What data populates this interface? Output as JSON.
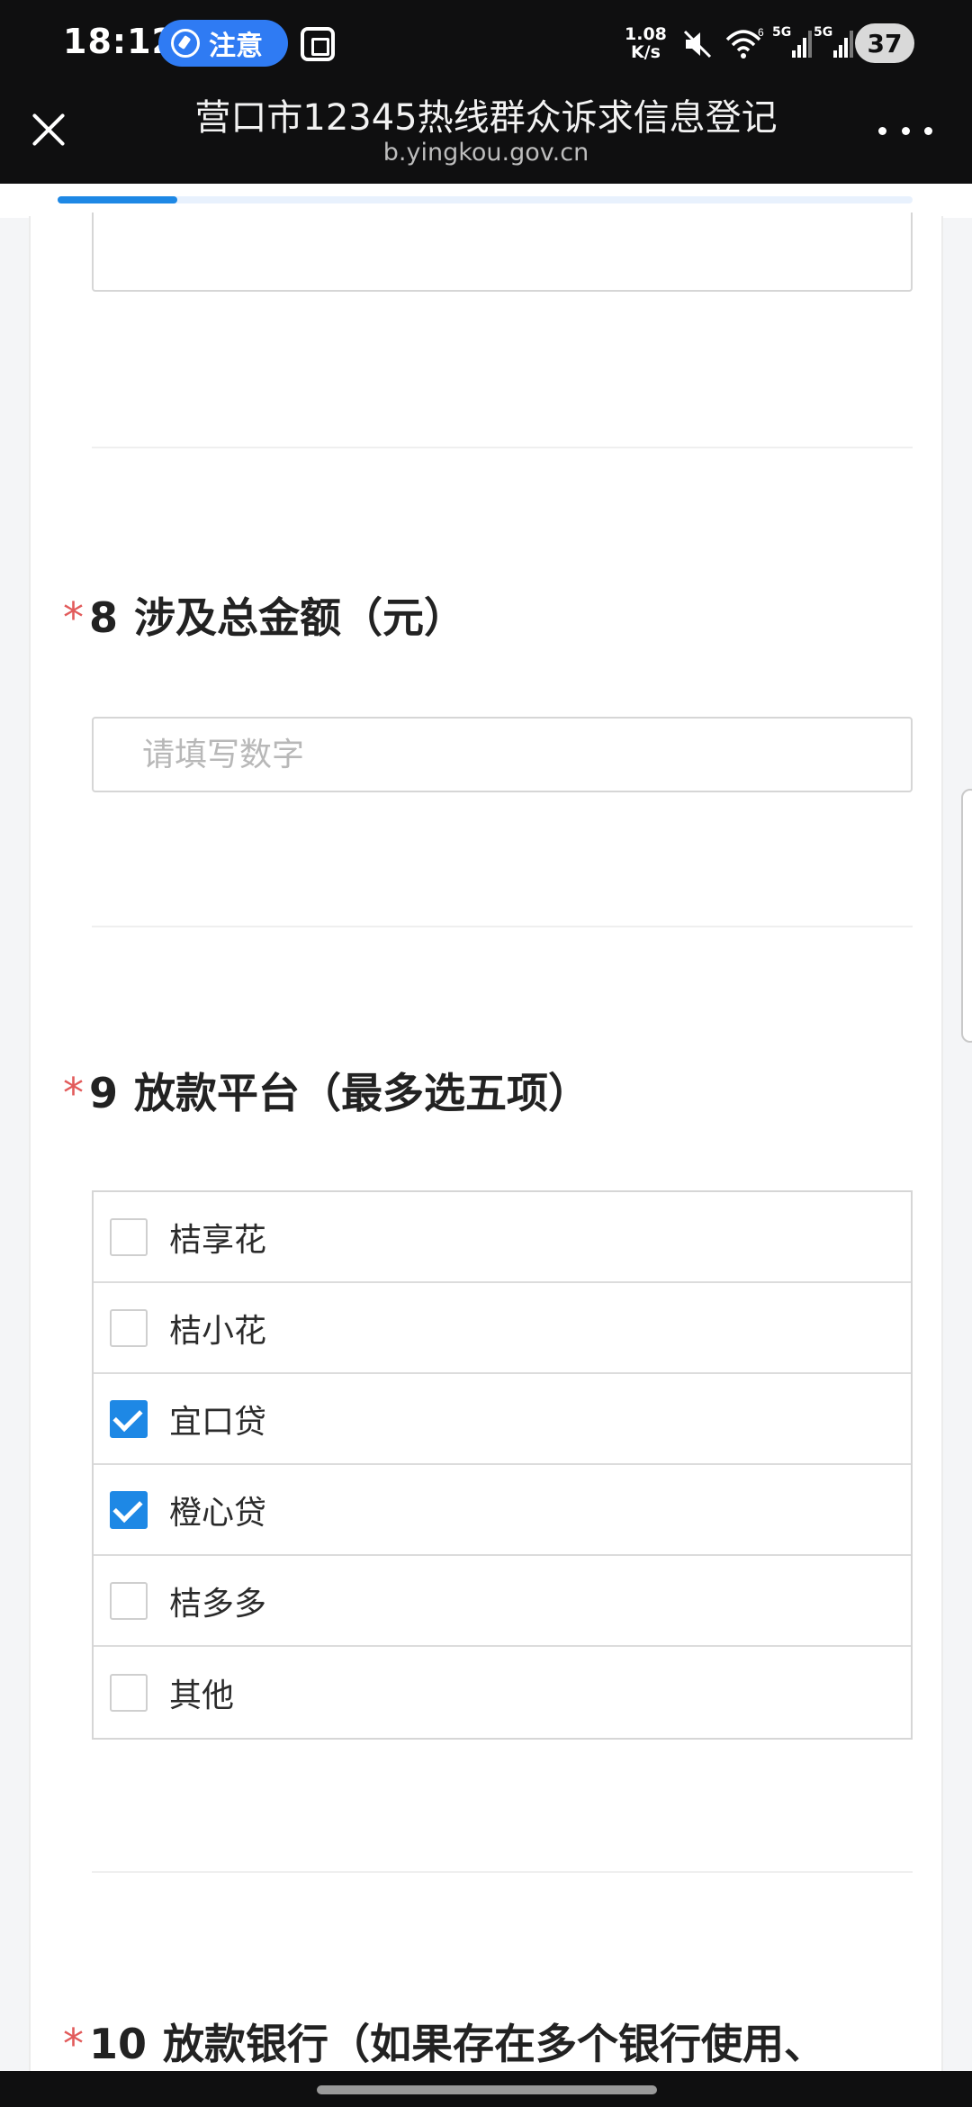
{
  "status_bar": {
    "time": "18:12",
    "notice_label": "注意",
    "net_speed_value": "1.08",
    "net_speed_unit": "K/s",
    "wifi_badge": "6",
    "sim1_label": "5G",
    "sim2_label": "5G",
    "battery": "37"
  },
  "browser": {
    "title": "营口市12345热线群众诉求信息登记",
    "url": "b.yingkou.gov.cn",
    "progress": 0.14
  },
  "form": {
    "q8": {
      "required_mark": "*",
      "number": "8",
      "title": "涉及总金额（元）",
      "placeholder": "请填写数字",
      "value": ""
    },
    "q9": {
      "required_mark": "*",
      "number": "9",
      "title": "放款平台（最多选五项）",
      "options": [
        {
          "label": "桔享花",
          "checked": false
        },
        {
          "label": "桔小花",
          "checked": false
        },
        {
          "label": "宜口贷",
          "checked": true
        },
        {
          "label": "橙心贷",
          "checked": true
        },
        {
          "label": "桔多多",
          "checked": false
        },
        {
          "label": "其他",
          "checked": false
        }
      ]
    },
    "q10": {
      "required_mark": "*",
      "number": "10",
      "title": "放款银行（如果存在多个银行使用、"
    }
  },
  "colors": {
    "accent": "#1e88e5",
    "required": "#e25b5b",
    "notice_pill": "#2f7bf3"
  }
}
